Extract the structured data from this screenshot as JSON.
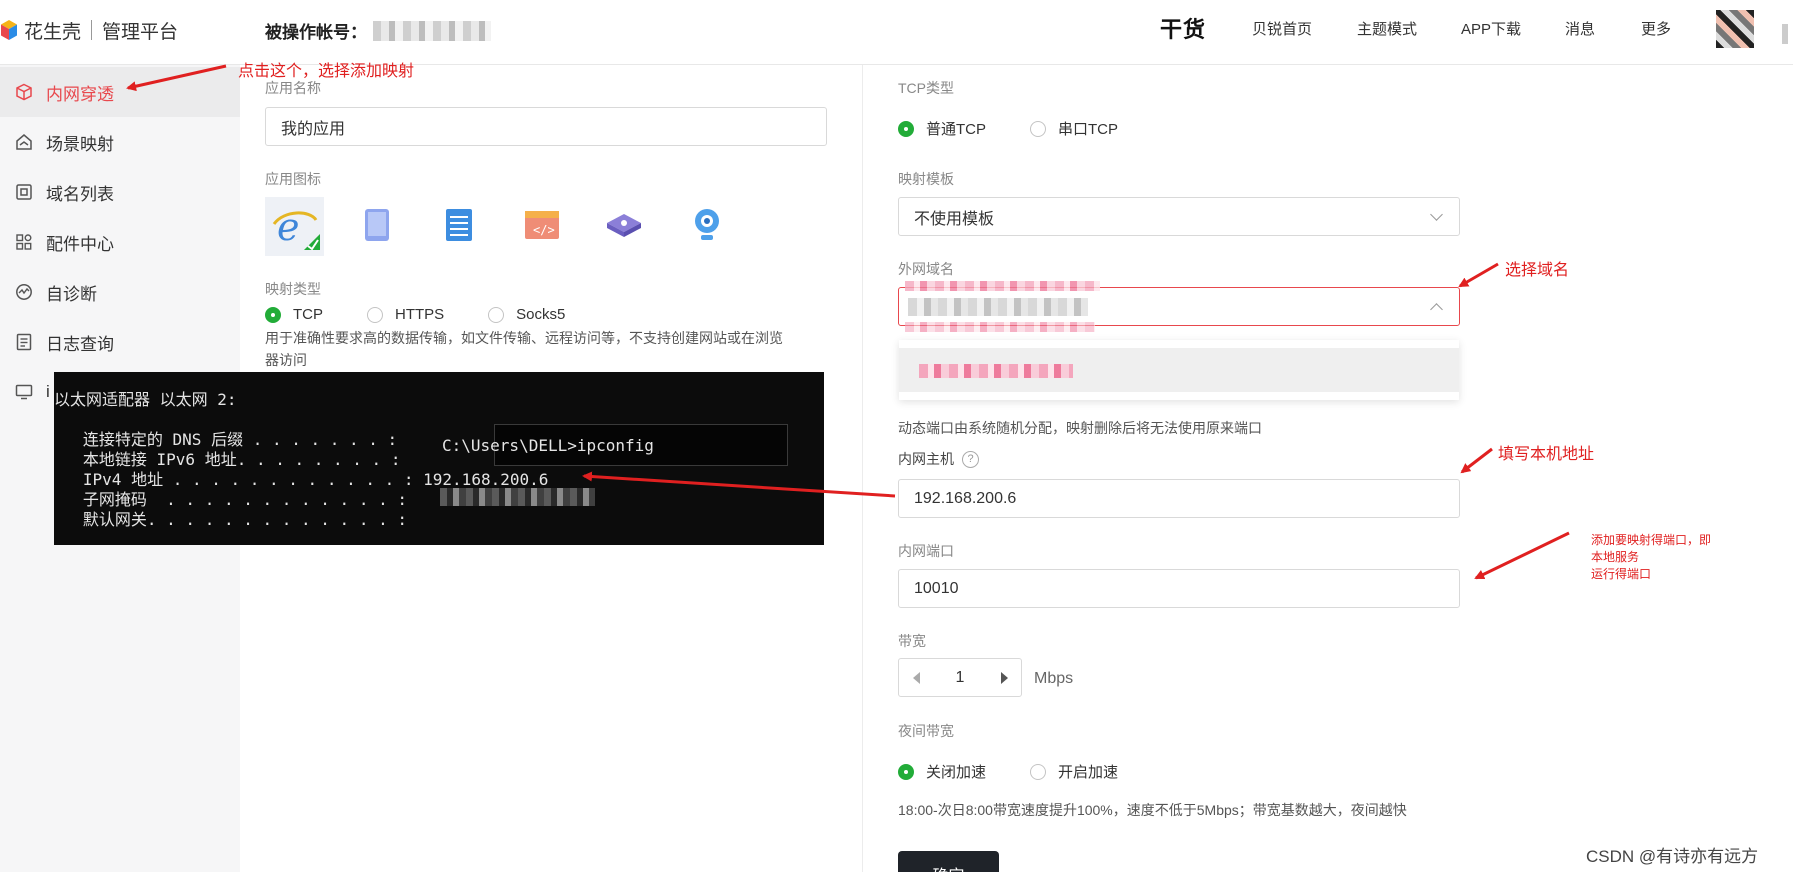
{
  "header": {
    "brand": "花生壳",
    "platform": "管理平台",
    "account_label": "被操作帐号：",
    "nav_items": [
      "干货",
      "贝锐首页",
      "主题模式",
      "APP下载",
      "消息",
      "更多"
    ]
  },
  "sidebar": {
    "items": [
      {
        "label": "内网穿透",
        "icon": "cube-icon",
        "active": true
      },
      {
        "label": "场景映射",
        "icon": "scene-icon",
        "active": false
      },
      {
        "label": "域名列表",
        "icon": "domain-icon",
        "active": false
      },
      {
        "label": "配件中心",
        "icon": "grid-icon",
        "active": false
      },
      {
        "label": "自诊断",
        "icon": "diagnose-icon",
        "active": false
      },
      {
        "label": "日志查询",
        "icon": "log-icon",
        "active": false
      },
      {
        "label": "i",
        "icon": "monitor-icon",
        "active": false
      }
    ]
  },
  "left_form": {
    "app_name_label": "应用名称",
    "app_name_value": "我的应用",
    "app_icon_label": "应用图标",
    "app_icons": [
      "ie-icon",
      "tablet-icon",
      "server-icon",
      "code-window-icon",
      "router-icon",
      "webcam-icon"
    ],
    "map_type_label": "映射类型",
    "map_types": [
      {
        "label": "TCP",
        "selected": true
      },
      {
        "label": "HTTPS",
        "selected": false
      },
      {
        "label": "Socks5",
        "selected": false
      }
    ],
    "map_type_desc_1": "用于准确性要求高的数据传输，如文件传输、远程访问等，不支持创建网站或在浏览",
    "map_type_desc_2": "器访问"
  },
  "terminal": {
    "header_line": "以太网适配器 以太网 2:",
    "lines": [
      "   连接特定的 DNS 后缀 . . . . . . . :",
      "   本地链接 IPv6 地址. . . . . . . . :",
      "   IPv4 地址 . . . . . . . . . . . . : 192.168.200.6",
      "   子网掩码  . . . . . . . . . . . . :",
      "   默认网关. . . . . . . . . . . . . :"
    ],
    "command": "C:\\Users\\DELL>ipconfig"
  },
  "right_form": {
    "tcp_type_label": "TCP类型",
    "tcp_types": [
      {
        "label": "普通TCP",
        "selected": true
      },
      {
        "label": "串口TCP",
        "selected": false
      }
    ],
    "template_label": "映射模板",
    "template_value": "不使用模板",
    "external_domain_label": "外网域名",
    "dynamic_port_note": "动态端口由系统随机分配，映射删除后将无法使用原来端口",
    "intranet_host_label": "内网主机",
    "intranet_host_value": "192.168.200.6",
    "intranet_port_label": "内网端口",
    "intranet_port_value": "10010",
    "bandwidth_label": "带宽",
    "bandwidth_value": "1",
    "bandwidth_unit": "Mbps",
    "night_bandwidth_label": "夜间带宽",
    "night_options": [
      {
        "label": "关闭加速",
        "selected": true
      },
      {
        "label": "开启加速",
        "selected": false
      }
    ],
    "night_note": "18:00-次日8:00带宽速度提升100%，速度不低于5Mbps；带宽基数越大，夜间越快",
    "confirm_label": "确定"
  },
  "annotations": {
    "click_this": "点击这个，选择添加映射",
    "select_domain": "选择域名",
    "fill_local": "填写本机地址",
    "port_note_1": "添加要映射得端口，即",
    "port_note_2": "本地服务",
    "port_note_3": "运行得端口",
    "annotation_color": "#e02020"
  },
  "watermark": "CSDN @有诗亦有远方",
  "colors": {
    "accent_red": "#e8484d",
    "radio_green": "#22ac38",
    "sidebar_bg": "#f6f6f7"
  }
}
